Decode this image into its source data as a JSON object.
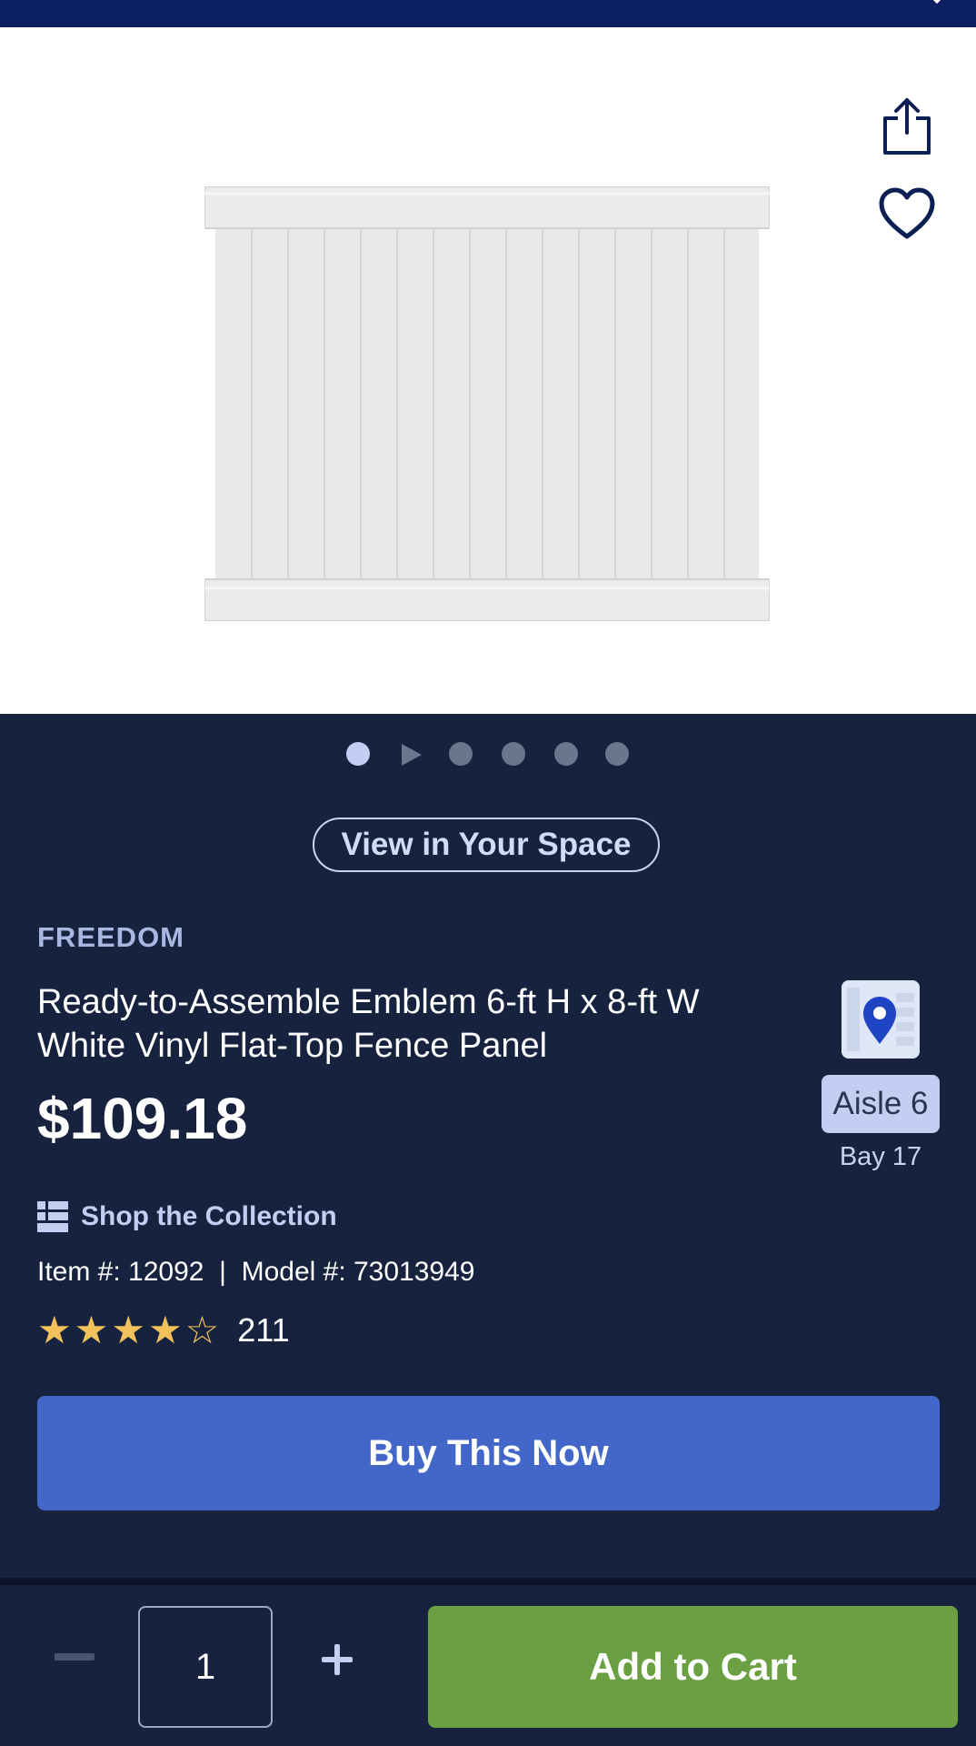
{
  "product": {
    "brand": "FREEDOM",
    "title": "Ready-to-Assemble Emblem 6-ft H x 8-ft W White Vinyl Flat-Top Fence Panel",
    "price": "$109.18",
    "item_line": "Item #: 12092  |  Model #: 73013949",
    "rating": 4,
    "review_count": "211"
  },
  "gallery": {
    "image_icon": "fence-panel-image",
    "dot_count": 6,
    "active_index": 0,
    "video_index": 1
  },
  "actions": {
    "share_icon": "share-icon",
    "favorite_icon": "heart-icon",
    "view_space_label": "View in Your Space",
    "collection_label": "Shop the Collection",
    "buy_label": "Buy This Now",
    "add_to_cart_label": "Add to Cart"
  },
  "location": {
    "aisle": "Aisle 6",
    "bay": "Bay 17"
  },
  "cart": {
    "quantity": "1"
  },
  "colors": {
    "background": "#16223e",
    "top_bar": "#0c1f63",
    "buy_button": "#4267c8",
    "add_to_cart": "#6aa042",
    "star": "#f2c15a"
  }
}
